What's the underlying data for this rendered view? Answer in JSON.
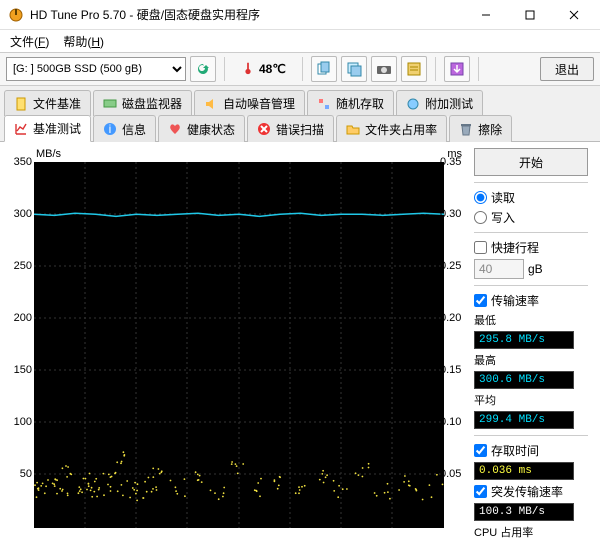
{
  "window": {
    "title": "HD Tune Pro 5.70 - 硬盘/固态硬盘实用程序"
  },
  "menu": {
    "file": "文件(",
    "file_u": "F",
    "file_tail": ")",
    "help": "帮助(",
    "help_u": "H",
    "help_tail": ")"
  },
  "toolbar": {
    "drive": "[G: ] 500GB SSD (500 gB)",
    "temp": "48℃",
    "exit": "退出"
  },
  "tabs_row1": [
    {
      "label": "文件基准"
    },
    {
      "label": "磁盘监视器"
    },
    {
      "label": "自动噪音管理"
    },
    {
      "label": "随机存取"
    },
    {
      "label": "附加测试"
    }
  ],
  "tabs_row2": [
    {
      "label": "基准测试",
      "active": true
    },
    {
      "label": "信息"
    },
    {
      "label": "健康状态"
    },
    {
      "label": "错误扫描"
    },
    {
      "label": "文件夹占用率"
    },
    {
      "label": "擦除"
    }
  ],
  "axes": {
    "left_unit": "MB/s",
    "right_unit": "ms",
    "left_ticks": [
      "350",
      "300",
      "250",
      "200",
      "150",
      "100",
      "50"
    ],
    "right_ticks": [
      "0.35",
      "0.30",
      "0.25",
      "0.20",
      "0.15",
      "0.10",
      "0.05"
    ]
  },
  "side": {
    "start": "开始",
    "read": "读取",
    "write": "写入",
    "shortstroke": "快捷行程",
    "shortstroke_val": "40",
    "shortstroke_unit": "gB",
    "transfer": "传输速率",
    "min": "最低",
    "min_val": "295.8 MB/s",
    "max": "最高",
    "max_val": "300.6 MB/s",
    "avg": "平均",
    "avg_val": "299.4 MB/s",
    "access": "存取时间",
    "access_val": "0.036 ms",
    "burst": "突发传输速率",
    "burst_val": "100.3 MB/s",
    "cpu": "CPU 占用率"
  },
  "chart_data": {
    "type": "line",
    "title": "",
    "xlabel": "",
    "ylabel": "MB/s",
    "x_range": [
      0,
      100
    ],
    "y_left": {
      "label": "MB/s",
      "range": [
        0,
        350
      ]
    },
    "y_right": {
      "label": "ms",
      "range": [
        0,
        0.35
      ]
    },
    "series": [
      {
        "name": "Transfer rate (MB/s)",
        "axis": "left",
        "x": [
          0,
          5,
          10,
          15,
          20,
          25,
          30,
          35,
          40,
          45,
          50,
          55,
          60,
          65,
          70,
          75,
          80,
          85,
          90,
          95,
          100
        ],
        "values": [
          300,
          299,
          301,
          300,
          298,
          300,
          299,
          300,
          301,
          299,
          300,
          298,
          300,
          301,
          299,
          300,
          300,
          299,
          300,
          301,
          300
        ]
      },
      {
        "name": "Access time (ms)",
        "axis": "right",
        "x": [
          0,
          2,
          4,
          6,
          8,
          10,
          12,
          14,
          16,
          18,
          20,
          22,
          24,
          26,
          28,
          30,
          35,
          40,
          45,
          50,
          55,
          60,
          65,
          70,
          75,
          80,
          85,
          90,
          95,
          100
        ],
        "values": [
          0.036,
          0.034,
          0.038,
          0.032,
          0.05,
          0.03,
          0.04,
          0.035,
          0.028,
          0.045,
          0.033,
          0.06,
          0.031,
          0.037,
          0.029,
          0.048,
          0.035,
          0.042,
          0.03,
          0.055,
          0.033,
          0.039,
          0.031,
          0.046,
          0.034,
          0.05,
          0.029,
          0.038,
          0.032,
          0.04
        ]
      }
    ]
  }
}
